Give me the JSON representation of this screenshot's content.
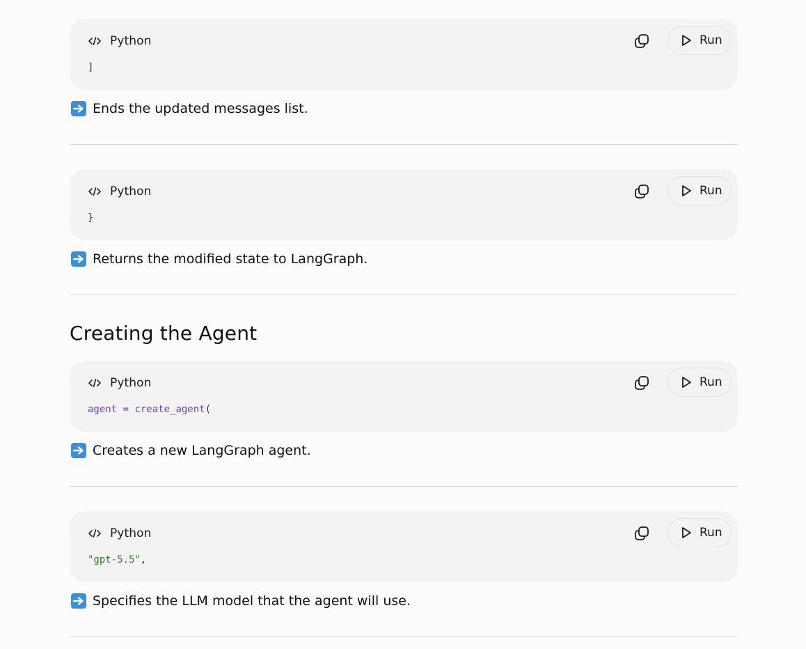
{
  "blocks": [
    {
      "language": "Python",
      "copy_icon": "copy-icon",
      "run_label": "Run",
      "code": [
        {
          "text": "]",
          "kind": "punc"
        }
      ],
      "explanation": "Ends the updated messages list."
    },
    {
      "language": "Python",
      "copy_icon": "copy-icon",
      "run_label": "Run",
      "code": [
        {
          "text": "}",
          "kind": "punc"
        }
      ],
      "explanation": "Returns the modified state to LangGraph."
    },
    {
      "language": "Python",
      "copy_icon": "copy-icon",
      "run_label": "Run",
      "code": [
        {
          "text": "agent",
          "kind": "var"
        },
        {
          "text": " = ",
          "kind": "op"
        },
        {
          "text": "create_agent",
          "kind": "fn"
        },
        {
          "text": "(",
          "kind": "punc"
        }
      ],
      "explanation": "Creates a new LangGraph agent."
    },
    {
      "language": "Python",
      "copy_icon": "copy-icon",
      "run_label": "Run",
      "code": [
        {
          "text": "\"gpt-5.5\"",
          "kind": "str"
        },
        {
          "text": ",",
          "kind": "punc"
        }
      ],
      "explanation": "Specifies the LLM model that the agent will use."
    }
  ],
  "section_heading": "Creating the Agent",
  "explanation_icon": "right-arrow-emoji-icon",
  "colors": {
    "code_background": "#f3f3f3",
    "string_token": "#2e7d32",
    "identifier_token": "#6b3fa0",
    "arrow_emoji": "#3b8fd9",
    "divider": "#d9d9d9"
  }
}
